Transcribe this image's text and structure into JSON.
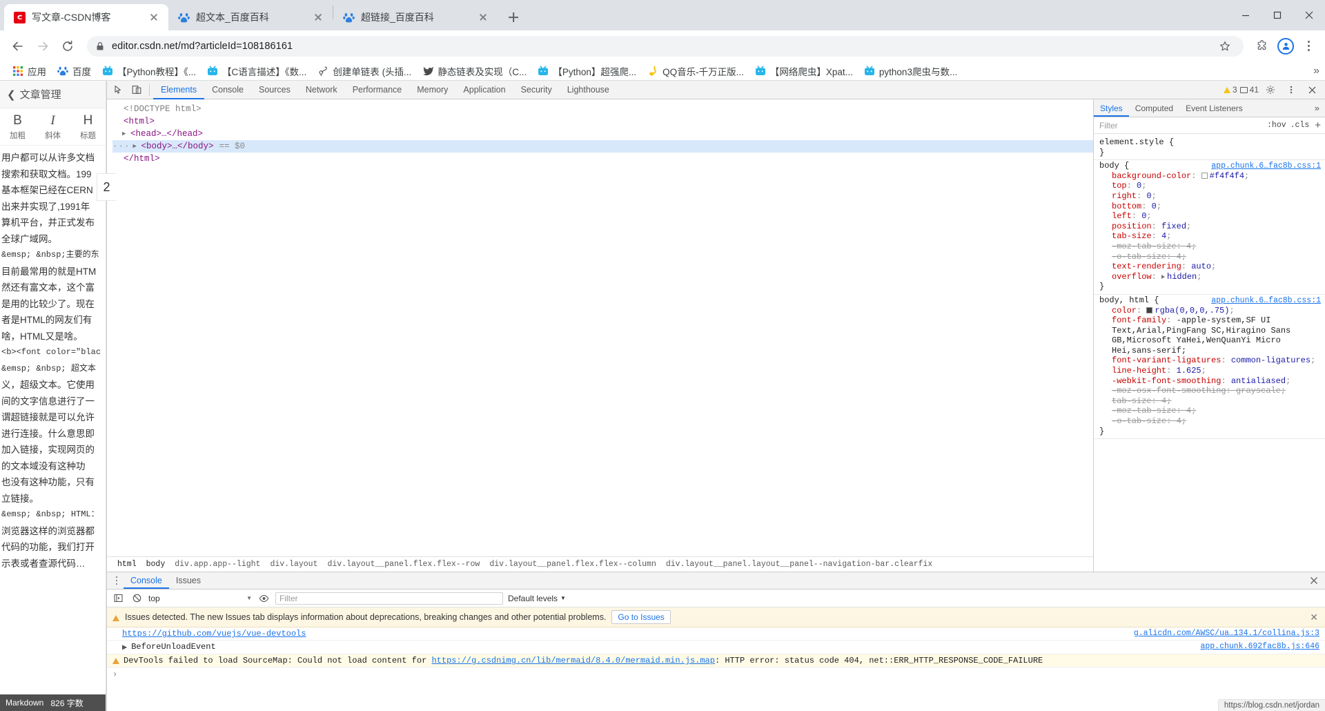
{
  "browser": {
    "tabs": [
      {
        "title": "写文章-CSDN博客",
        "favicon": "csdn-icon",
        "active": true
      },
      {
        "title": "超文本_百度百科",
        "favicon": "baidu-icon",
        "active": false
      },
      {
        "title": "超链接_百度百科",
        "favicon": "baidu-icon",
        "active": false
      }
    ],
    "new_tab_label": "+",
    "window_controls": [
      "minimize-button",
      "maximize-button",
      "close-button"
    ],
    "toolbar": {
      "back_icon": "arrow-back-icon",
      "forward_icon": "arrow-forward-icon",
      "reload_icon": "reload-icon",
      "lock_icon": "lock-icon",
      "url": "editor.csdn.net/md?articleId=108186161",
      "star_icon": "bookmark-star-icon",
      "extensions_icon": "puzzle-piece-icon",
      "profile_icon": "profile-avatar-icon",
      "menu_icon": "three-dot-menu-icon"
    },
    "bookmarks": [
      {
        "label": "应用",
        "icon": "apps-grid-icon"
      },
      {
        "label": "百度",
        "icon": "baidu-icon"
      },
      {
        "label": "【Python教程】《...",
        "icon": "bilibili-icon"
      },
      {
        "label": "【C语言描述】《数...",
        "icon": "bilibili-icon"
      },
      {
        "label": "创建单链表 (头插...",
        "icon": "csdn-pen-icon"
      },
      {
        "label": "静态链表及实现（C...",
        "icon": "bird-icon"
      },
      {
        "label": "【Python】超强爬...",
        "icon": "bilibili-icon"
      },
      {
        "label": "QQ音乐-千万正版...",
        "icon": "qqmusic-icon"
      },
      {
        "label": "【网络爬虫】Xpat...",
        "icon": "bilibili-icon"
      },
      {
        "label": "python3爬虫与数...",
        "icon": "bilibili-icon"
      }
    ],
    "bookmarks_overflow": "»"
  },
  "editor": {
    "back_icon": "chevron-left-icon",
    "title": "文章管理",
    "title_input_value": "2",
    "toolbar": [
      {
        "glyph": "B",
        "label": "加粗",
        "name": "bold"
      },
      {
        "glyph": "I",
        "label": "斜体",
        "name": "italic"
      },
      {
        "glyph": "H",
        "label": "标题",
        "name": "heading"
      }
    ],
    "content_lines": [
      "用户都可以从许多文档",
      "搜索和获取文档。199",
      "基本框架已经在CERN",
      "出来并实现了,1991年",
      "算机平台，并正式发布",
      "全球广域网。",
      "&emsp;  &nbsp;主要的东",
      "目前最常用的就是HTM",
      "然还有富文本，这个富",
      "是用的比较少了。现在",
      "者是HTML的网友们有",
      "啥，HTML又是啥。",
      "",
      "<b><font color=\"black\" si",
      "&emsp;  &nbsp; 超文本",
      "义，超级文本。它使用",
      "间的文字信息进行了一",
      "谓超链接就是可以允许",
      "进行连接。什么意思即",
      "加入链接，实现网页的",
      "的文本域没有这种功",
      "也没有这种功能，只有",
      "立链接。",
      "&emsp;  &nbsp; HTML：",
      "浏览器这样的浏览器都",
      "代码的功能，我们打开",
      "示表或者查源代码…"
    ],
    "status": {
      "mode": "Markdown",
      "count": "826 字数"
    }
  },
  "devtools": {
    "inspect_icon": "inspect-cursor-icon",
    "device_icon": "device-toolbar-icon",
    "tabs": [
      {
        "label": "Elements",
        "selected": true
      },
      {
        "label": "Console",
        "selected": false
      },
      {
        "label": "Sources",
        "selected": false
      },
      {
        "label": "Network",
        "selected": false
      },
      {
        "label": "Performance",
        "selected": false
      },
      {
        "label": "Memory",
        "selected": false
      },
      {
        "label": "Application",
        "selected": false
      },
      {
        "label": "Security",
        "selected": false
      },
      {
        "label": "Lighthouse",
        "selected": false
      }
    ],
    "warning_count": "3",
    "message_count": "41",
    "settings_icon": "gear-icon",
    "menu_icon": "three-dot-menu-icon",
    "close_icon": "close-icon",
    "dom": [
      {
        "indent": 0,
        "tri": "",
        "text": "<!DOCTYPE html>",
        "cls": "doctypec",
        "selected": false
      },
      {
        "indent": 0,
        "tri": "",
        "text": "<html>",
        "cls": "tagc",
        "selected": false
      },
      {
        "indent": 1,
        "tri": "▶",
        "text": "<head>…</head>",
        "cls": "tagc",
        "selected": false
      },
      {
        "indent": 1,
        "tri": "▶",
        "text": "<body>…</body>",
        "cls": "tagc",
        "selected": true,
        "suffix": "== $0",
        "dots": "···"
      },
      {
        "indent": 0,
        "tri": "",
        "text": "</html>",
        "cls": "tagc",
        "selected": false
      }
    ],
    "breadcrumb": [
      "html",
      "body",
      "div.app.app--light",
      "div.layout",
      "div.layout__panel.flex.flex--row",
      "div.layout__panel.flex.flex--column",
      "div.layout__panel.layout__panel--navigation-bar.clearfix"
    ],
    "styles": {
      "tabs": [
        {
          "label": "Styles",
          "selected": true
        },
        {
          "label": "Computed",
          "selected": false
        },
        {
          "label": "Event Listeners",
          "selected": false
        }
      ],
      "more": "»",
      "filter_placeholder": "Filter",
      "hov_label": ":hov",
      "cls_label": ".cls",
      "plus_label": "+",
      "rules": [
        {
          "selector": "element.style {",
          "source": "",
          "close": "}",
          "props": []
        },
        {
          "selector": "body {",
          "source": "app.chunk.6…fac8b.css:1",
          "close": "}",
          "props": [
            {
              "key": "background-color",
              "value": "#f4f4f4",
              "swatch": "#f4f4f4",
              "strike": false
            },
            {
              "key": "top",
              "value": "0",
              "strike": false
            },
            {
              "key": "right",
              "value": "0",
              "strike": false
            },
            {
              "key": "bottom",
              "value": "0",
              "strike": false
            },
            {
              "key": "left",
              "value": "0",
              "strike": false
            },
            {
              "key": "position",
              "value": "fixed",
              "strike": false
            },
            {
              "key": "tab-size",
              "value": "4",
              "strike": false
            },
            {
              "key": "-moz-tab-size",
              "value": "4",
              "strike": true
            },
            {
              "key": "-o-tab-size",
              "value": "4",
              "strike": true
            },
            {
              "key": "text-rendering",
              "value": "auto",
              "strike": false
            },
            {
              "key": "overflow",
              "value": "hidden",
              "strike": false,
              "expand": true
            }
          ]
        },
        {
          "selector": "body, html {",
          "source": "app.chunk.6…fac8b.css:1",
          "close": "}",
          "props": [
            {
              "key": "color",
              "value": "rgba(0,0,0,.75)",
              "swatch": "#404040",
              "strike": false
            },
            {
              "key": "font-family",
              "value": "-apple-system,SF UI Text,Arial,PingFang SC,Hiragino Sans GB,Microsoft YaHei,WenQuanYi Micro Hei,sans-serif;",
              "strike": false,
              "wrap": true
            },
            {
              "key": "font-variant-ligatures",
              "value": "common-ligatures",
              "strike": false
            },
            {
              "key": "line-height",
              "value": "1.625",
              "strike": false
            },
            {
              "key": "-webkit-font-smoothing",
              "value": "antialiased",
              "strike": false
            },
            {
              "key": "-moz-osx-font-smoothing",
              "value": "grayscale",
              "strike": true
            },
            {
              "key": "tab-size",
              "value": "4",
              "strike": true
            },
            {
              "key": "-moz-tab-size",
              "value": "4",
              "strike": true
            },
            {
              "key": "-o-tab-size",
              "value": "4",
              "strike": true
            }
          ]
        }
      ]
    },
    "drawer": {
      "tabs": [
        {
          "label": "Console",
          "selected": true
        },
        {
          "label": "Issues",
          "selected": false
        }
      ],
      "close_icon": "close-icon",
      "execute_icon": "execution-context-icon",
      "clear_icon": "clear-console-icon",
      "context": "top",
      "eye_icon": "live-expression-icon",
      "filter_placeholder": "Filter",
      "levels": "Default levels",
      "issue_banner": {
        "text": "Issues detected. The new Issues tab displays information about deprecations, breaking changes and other potential problems.",
        "button": "Go to Issues"
      },
      "messages": [
        {
          "type": "link",
          "text": "https://github.com/vuejs/vue-devtools",
          "source": "g.alicdn.com/AWSC/ua…134.1/collina.js:3"
        },
        {
          "type": "object",
          "tri": "▶",
          "text": "BeforeUnloadEvent",
          "source": "app.chunk.692fac8b.js:646"
        },
        {
          "type": "warning",
          "text": "DevTools failed to load SourceMap: Could not load content for ",
          "link": "https://g.csdnimg.cn/lib/mermaid/8.4.0/mermaid.min.js.map",
          "text_after": ": HTTP error: status code 404, net::ERR_HTTP_RESPONSE_CODE_FAILURE",
          "source": ""
        }
      ],
      "prompt": "›"
    }
  },
  "status_url": "https://blog.csdn.net/jordan",
  "colors": {
    "accent": "#1a73e8",
    "tabstrip_bg": "#dee1e6",
    "devtools_bg": "#f3f3f3",
    "warning_bg": "#fdf6e3"
  }
}
